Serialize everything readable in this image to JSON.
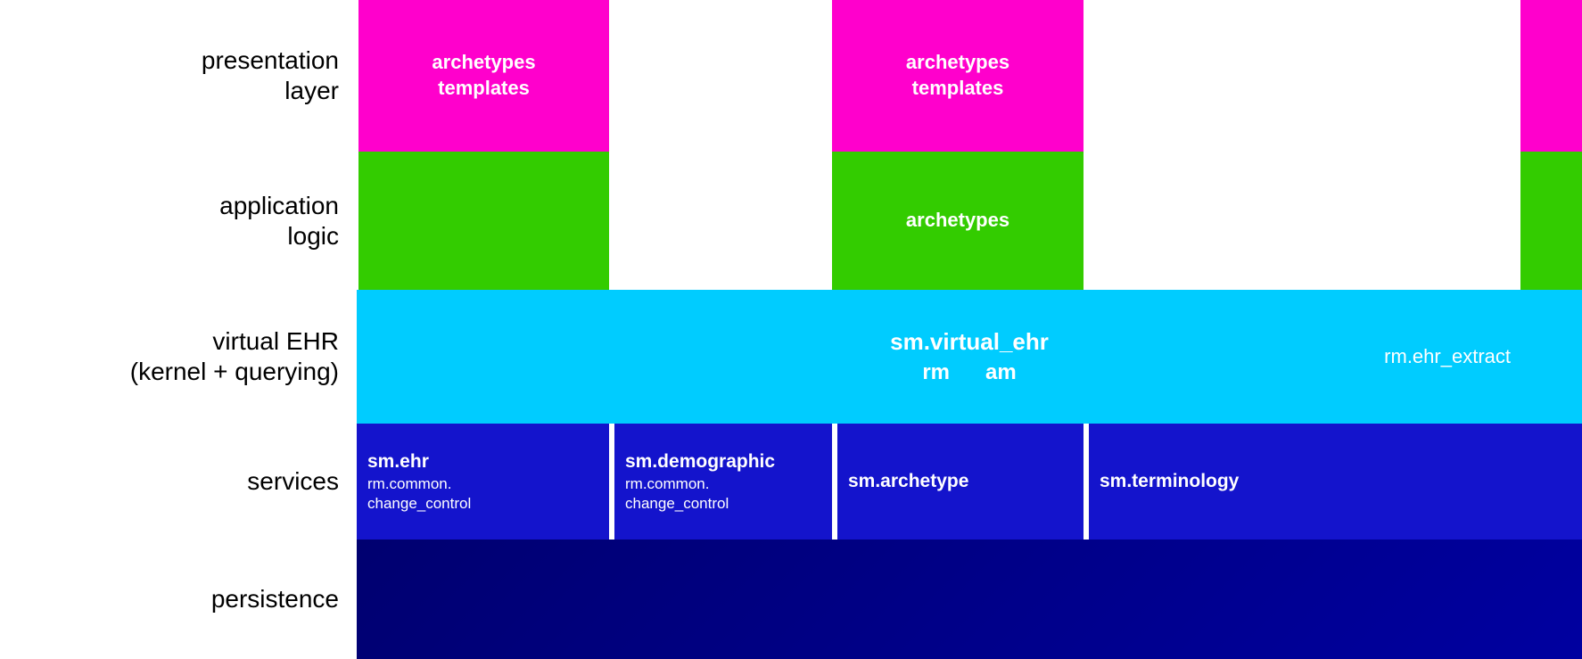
{
  "layers": {
    "presentation": {
      "label": "presentation\nlayer",
      "block1_text": "archetypes\ntemplates",
      "block2_text": "archetypes\ntemplates",
      "block3_text": ""
    },
    "application": {
      "label": "application\nlogic",
      "block1_text": "",
      "block2_text": "archetypes",
      "block3_text": ""
    },
    "virtual_ehr": {
      "label": "virtual EHR\n(kernel + querying)",
      "main_text": "sm.virtual_ehr",
      "sub_left": "rm",
      "sub_right": "am",
      "right_text": "rm.ehr_extract"
    },
    "services": {
      "label": "services",
      "block1_title": "sm.ehr",
      "block1_sub": "rm.common.\nchange_control",
      "block2_title": "sm.demographic",
      "block2_sub": "rm.common.\nchange_control",
      "block3_title": "sm.archetype",
      "block4_title": "sm.terminology"
    },
    "persistence": {
      "label": "persistence"
    }
  },
  "colors": {
    "magenta": "#ff00cc",
    "green": "#33cc00",
    "cyan": "#00ccff",
    "blue": "#1414cc",
    "navy": "#000070",
    "white": "#ffffff",
    "black": "#000000"
  }
}
